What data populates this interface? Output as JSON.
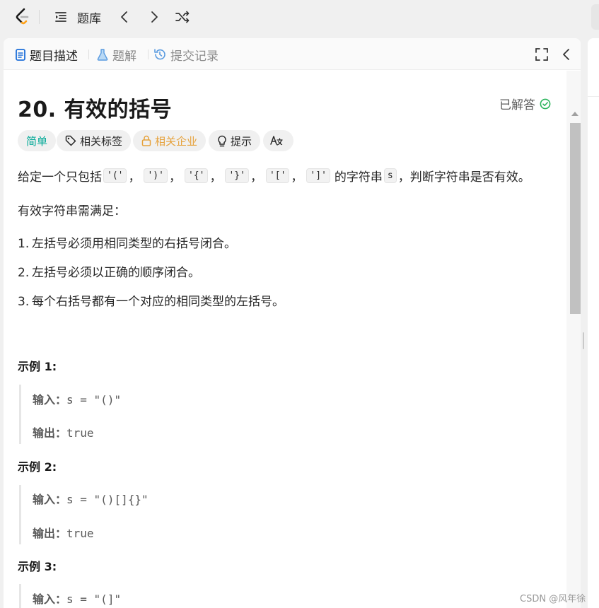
{
  "topnav": {
    "problem_list_label": "题库"
  },
  "tabs": {
    "description": "题目描述",
    "solutions": "题解",
    "submissions": "提交记录"
  },
  "problem": {
    "title": "20. 有效的括号",
    "solved_label": "已解答",
    "chips": {
      "difficulty": "简单",
      "tags": "相关标签",
      "companies": "相关企业",
      "hint": "提示",
      "translate": "A文"
    },
    "statement": {
      "prefix": "给定一个只包括",
      "codes": [
        "'('",
        "')'",
        "'{'",
        "'}'",
        "'['",
        "']'"
      ],
      "sep": "，",
      "middle": "的字符串",
      "var": "s",
      "suffix": "，判断字符串是否有效。"
    },
    "rules_intro": "有效字符串需满足：",
    "rules": [
      {
        "num": "1.",
        "text": "左括号必须用相同类型的右括号闭合。"
      },
      {
        "num": "2.",
        "text": "左括号必须以正确的顺序闭合。"
      },
      {
        "num": "3.",
        "text": "每个右括号都有一个对应的相同类型的左括号。"
      }
    ],
    "examples": [
      {
        "title": "示例 1:",
        "input_label": "输入：",
        "input": "s = \"()\"",
        "output_label": "输出：",
        "output": "true"
      },
      {
        "title": "示例 2:",
        "input_label": "输入：",
        "input": "s = \"()[]{}\"",
        "output_label": "输出：",
        "output": "true"
      },
      {
        "title": "示例 3:",
        "input_label": "输入：",
        "input": "s = \"(]\""
      }
    ]
  },
  "watermark": "CSDN @风年徐",
  "colors": {
    "easy": "#00a896",
    "company": "#e6a23c",
    "solved_check": "#2db55d",
    "brand_orange": "#ffa116"
  }
}
